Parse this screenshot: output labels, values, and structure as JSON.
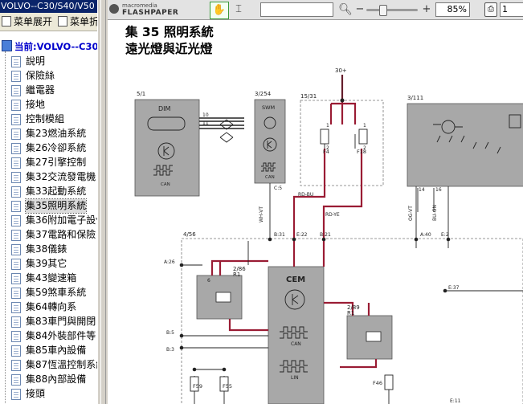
{
  "left_panel": {
    "title": "VOLVO--C30/S40/V50",
    "toolbar": {
      "expand": "菜单展开",
      "collapse": "菜单折"
    },
    "root": "当前:VOLVO--C30",
    "items": [
      "說明",
      "保險絲",
      "繼電器",
      "接地",
      "控制模組",
      "集23燃油系統",
      "集26冷卻系統",
      "集27引擎控制",
      "集32交流發電機",
      "集33起動系統",
      "集35照明系統",
      "集36附加電子設備",
      "集37電路和保險",
      "集38儀錶",
      "集39其它",
      "集43變速箱",
      "集59煞車系統",
      "集64轉向系",
      "集83車門與開閉",
      "集84外裝部件等",
      "集85車內設備",
      "集87恆溫控制系統",
      "集88內部設備",
      "接頭"
    ],
    "selected_index": 10
  },
  "viewer_toolbar": {
    "logo_line1": "macromedia",
    "logo_line2": "FLASHPAPER",
    "search_value": "",
    "zoom": "85%",
    "zoom_fraction": 0.3,
    "page": "1",
    "icons": [
      "hand-icon",
      "select-icon",
      "search-icon",
      "zoom-out-icon",
      "zoom-in-icon",
      "print-icon"
    ]
  },
  "document": {
    "title_line1": "集 35 照明系統",
    "title_line2": "遠光燈與近光燈",
    "wire_color": "#9a1c34",
    "component_fill": "#a8a8a8",
    "labels": {
      "dim_id": "5/1",
      "dim": "DIM",
      "dim_can": "CAN",
      "swm_id": "3/254",
      "swm": "SWM",
      "swm_can": "CAN",
      "fuse_box_id": "15/31",
      "fuse_f4": "F4",
      "fuse_f18": "F18",
      "supply": "30+",
      "right_box_id": "3/111",
      "cem_box_id": "4/56",
      "cem": "CEM",
      "cem_can": "CAN",
      "cem_lin": "LIN",
      "relay1_id": "2/86",
      "relay1_r": "R1",
      "relay2_id": "2/89",
      "relay2_r": "R1",
      "fuse_f59": "F59",
      "fuse_f55": "F55",
      "fuse_f46": "F46",
      "wire_rd_bu": "RD-BU",
      "wire_rd_ye": "RD-YE",
      "wire_wh_vt": "WH-VT",
      "wire_og_vt": "OG-VT",
      "wire_bu_gn": "BU-GN",
      "conn_b31": "B:31",
      "conn_e22": "E:22",
      "conn_b21": "B:21",
      "conn_a40": "A:40",
      "conn_e2": "E:2",
      "conn_a26": "A:26",
      "conn_e37": "E:37",
      "conn_b5": "B:5",
      "conn_b3": "B:3",
      "conn_c5": "C:5",
      "conn_e11": "E:11",
      "pin_10": "10",
      "pin_11": "11",
      "pin_14": "14",
      "pin_16": "16",
      "pin_1a": "1",
      "pin_1b": "1",
      "pin_2a": "2",
      "pin_2b": "2",
      "pin_6": "6"
    }
  }
}
